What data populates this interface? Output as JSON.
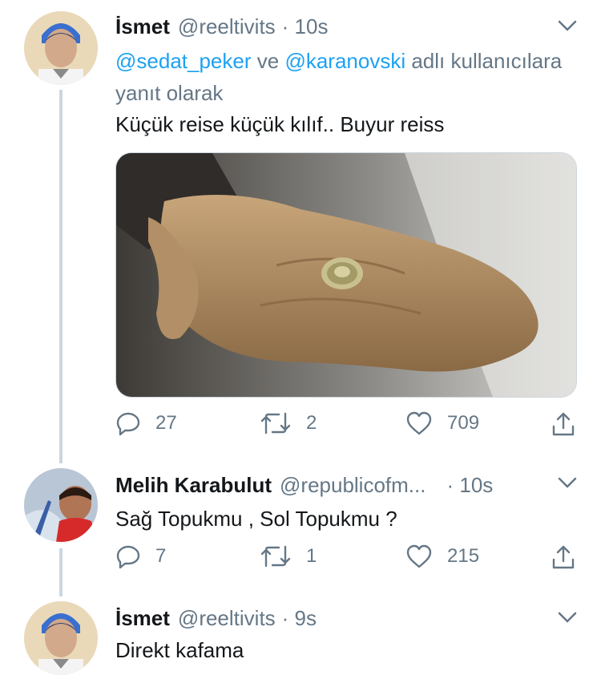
{
  "tweets": [
    {
      "name": "İsmet",
      "handle": "@reeltivits",
      "time": "· 10s",
      "reply_mentions": [
        "@sedat_peker",
        "@karanovski"
      ],
      "reply_and": "ve",
      "reply_suffix": "adlı kullanıcılara yanıt olarak",
      "text": "Küçük reise küçük kılıf.. Buyur reiss",
      "replies": "27",
      "retweets": "2",
      "likes": "709"
    },
    {
      "name": "Melih Karabulut",
      "handle": "@republicofm...",
      "time": "· 10s",
      "text": "Sağ Topukmu  , Sol Topukmu ?",
      "replies": "7",
      "retweets": "1",
      "likes": "215"
    },
    {
      "name": "İsmet",
      "handle": "@reeltivits",
      "time": "· 9s",
      "text": "Direkt kafama"
    }
  ],
  "icons": {
    "reply": "reply-icon",
    "retweet": "retweet-icon",
    "like": "heart-icon",
    "share": "share-icon",
    "menu": "chevron-down-icon"
  },
  "colors": {
    "mention": "#1da1f2",
    "secondary": "#657786",
    "thread_line": "#ccd6dd"
  }
}
